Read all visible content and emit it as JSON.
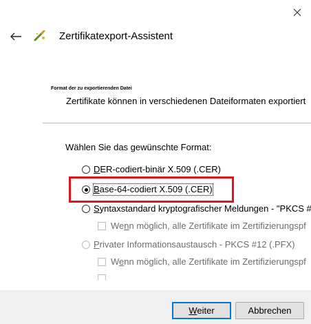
{
  "window": {
    "title": "Zertifikatexport-Assistent",
    "close_icon": "close-icon",
    "back_icon": "back-arrow-icon",
    "wizard_icon": "certificate-wizard-icon"
  },
  "section": {
    "heading": "Format der zu exportierenden Datei",
    "description": "Zertifikate können in verschiedenen Dateiformaten exportiert"
  },
  "format": {
    "prompt": "Wählen Sie das gewünschte Format:",
    "options": [
      {
        "key": "D",
        "rest": "ER-codiert-binär X.509 (.CER)",
        "selected": false,
        "enabled": true
      },
      {
        "key": "B",
        "rest": "ase-64-codiert X.509 (.CER)",
        "selected": true,
        "enabled": true
      },
      {
        "key": "S",
        "rest": "yntaxstandard kryptografischer Meldungen - \"PKCS #",
        "selected": false,
        "enabled": true
      },
      {
        "key": "P",
        "rest": "rivater Informationsaustausch - PKCS #12 (.PFX)",
        "selected": false,
        "enabled": false
      }
    ],
    "checkbox_1": {
      "pre": "We",
      "key": "n",
      "rest": "n möglich, alle Zertifikate im Zertifizierungspf",
      "checked": false,
      "enabled": false
    },
    "checkbox_2": {
      "pre": "W",
      "key": "e",
      "rest": "nn möglich, alle Zertifikate im Zertifizierungspf",
      "checked": false,
      "enabled": false
    }
  },
  "buttons": {
    "next": {
      "key": "W",
      "rest": "eiter"
    },
    "cancel": "Abbrechen"
  },
  "colors": {
    "highlight": "#e0141c",
    "footer_bg": "#f0f0f0",
    "primary_border": "#0078d7"
  }
}
